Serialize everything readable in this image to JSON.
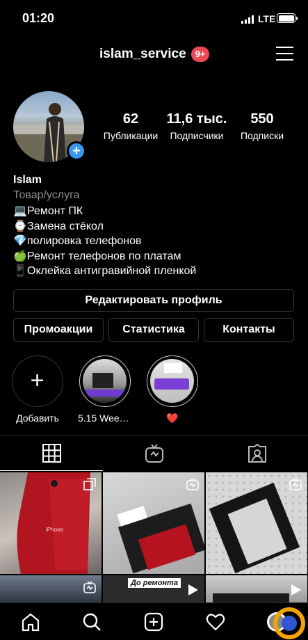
{
  "status_bar": {
    "time": "01:20",
    "network": "LTE"
  },
  "header": {
    "username": "islam_service",
    "notifications": "9+"
  },
  "profile": {
    "stats": [
      {
        "value": "62",
        "label": "Публикации"
      },
      {
        "value": "11,6 тыс.",
        "label": "Подписчики"
      },
      {
        "value": "550",
        "label": "Подписки"
      }
    ]
  },
  "bio": {
    "name": "Islam",
    "category": "Товар/услуга",
    "lines": [
      {
        "emoji": "💻",
        "text": "Ремонт ПК"
      },
      {
        "emoji": "⌚",
        "text": "Замена стёкол"
      },
      {
        "emoji": "💎",
        "text": "полировка телефонов"
      },
      {
        "emoji": "🍏",
        "text": "Ремонт телефонов по платам"
      },
      {
        "emoji": "📱",
        "text": "Оклейка антигравийной пленкой"
      }
    ]
  },
  "buttons": {
    "edit": "Редактировать профиль",
    "promo": "Промоакции",
    "stats": "Статистика",
    "contacts": "Контакты"
  },
  "highlights": [
    {
      "caption": "Добавить"
    },
    {
      "caption": "5.15 Weeke..."
    },
    {
      "caption": "❤️"
    }
  ],
  "posts": {
    "tile_texts": [
      "iPhone",
      "До ремонта"
    ]
  },
  "colors": {
    "accent": "#3897f0",
    "badge": "#ed4956",
    "border": "#363636",
    "muted": "#8e8e8e"
  },
  "icons": {
    "tabs": [
      "grid-icon",
      "igtv-icon",
      "tagged-icon"
    ],
    "nav": [
      "home-icon",
      "search-icon",
      "new-post-icon",
      "heart-icon",
      "profile-icon"
    ]
  }
}
